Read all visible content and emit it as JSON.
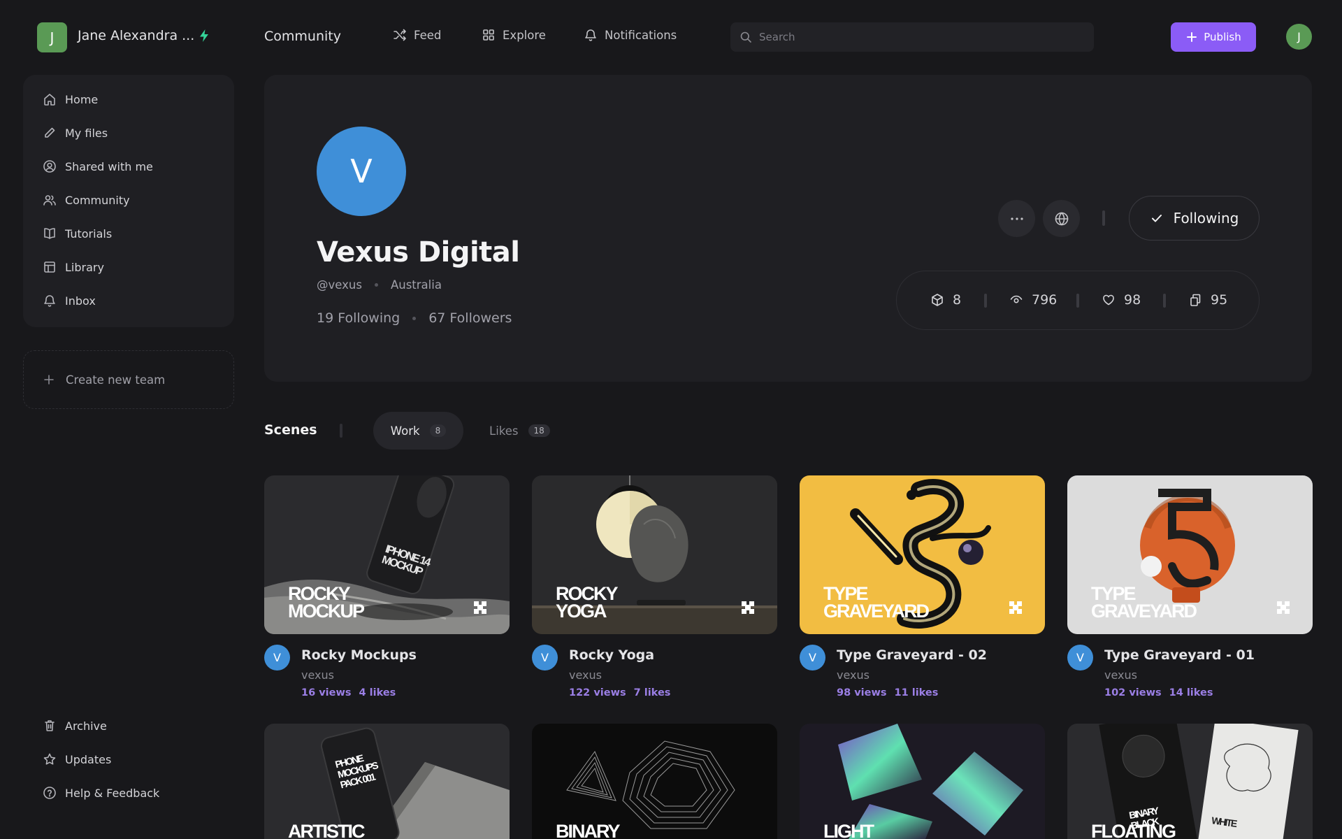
{
  "workspace": {
    "avatar_letter": "J",
    "name": "Jane Alexandra ...",
    "accent": "#34d399"
  },
  "header": {
    "page_title": "Community",
    "nav": [
      {
        "label": "Feed",
        "icon": "shuffle-icon"
      },
      {
        "label": "Explore",
        "icon": "grid-icon"
      },
      {
        "label": "Notifications",
        "icon": "bell-icon"
      }
    ],
    "search_placeholder": "Search",
    "publish_label": "Publish",
    "publish_color": "#8b5cf6",
    "user_avatar_letter": "J"
  },
  "sidebar": {
    "items": [
      {
        "label": "Home",
        "icon": "home-icon"
      },
      {
        "label": "My files",
        "icon": "pencil-icon"
      },
      {
        "label": "Shared with me",
        "icon": "user-circle-icon"
      },
      {
        "label": "Community",
        "icon": "users-icon"
      },
      {
        "label": "Tutorials",
        "icon": "book-icon"
      },
      {
        "label": "Library",
        "icon": "library-icon"
      },
      {
        "label": "Inbox",
        "icon": "bell-icon"
      }
    ],
    "create_team_label": "Create new team",
    "bottom_items": [
      {
        "label": "Archive",
        "icon": "trash-icon"
      },
      {
        "label": "Updates",
        "icon": "star-icon"
      },
      {
        "label": "Help & Feedback",
        "icon": "help-circle-icon"
      }
    ]
  },
  "profile": {
    "avatar_letter": "V",
    "name": "Vexus Digital",
    "handle": "@vexus",
    "location": "Australia",
    "following": "19 Following",
    "followers": "67 Followers",
    "follow_button_label": "Following",
    "stats": [
      {
        "icon": "cube-icon",
        "value": "8"
      },
      {
        "icon": "eye-icon",
        "value": "796"
      },
      {
        "icon": "heart-icon",
        "value": "98"
      },
      {
        "icon": "copy-icon",
        "value": "95"
      }
    ]
  },
  "scenes": {
    "title": "Scenes",
    "tabs": [
      {
        "label": "Work",
        "count": "8"
      },
      {
        "label": "Likes",
        "count": "18"
      }
    ],
    "cards": [
      {
        "title": "Rocky Mockups",
        "author": "vexus",
        "views": "16 views",
        "likes": "4 likes",
        "thumb_text": [
          "ROCKY",
          "MOCKUP"
        ],
        "phone_text": [
          "IPHONE 14",
          "MOCKUP"
        ]
      },
      {
        "title": "Rocky Yoga",
        "author": "vexus",
        "views": "122 views",
        "likes": "7 likes",
        "thumb_text": [
          "ROCKY",
          "YOGA"
        ]
      },
      {
        "title": "Type Graveyard - 02",
        "author": "vexus",
        "views": "98 views",
        "likes": "11 likes",
        "thumb_text": [
          "TYPE",
          "GRAVEYARD"
        ]
      },
      {
        "title": "Type Graveyard - 01",
        "author": "vexus",
        "views": "102 views",
        "likes": "14 likes",
        "thumb_text": [
          "TYPE",
          "GRAVEYARD"
        ]
      },
      {
        "thumb_text": [
          "ARTISTIC"
        ],
        "phone_text": [
          "PHONE",
          "MOCKUPS",
          "PACK 001"
        ]
      },
      {
        "thumb_text": [
          "BINARY"
        ]
      },
      {
        "thumb_text": [
          "LIGHT"
        ]
      },
      {
        "thumb_text": [
          "FLOATING"
        ],
        "phone_text": [
          "BINARY",
          "BLACK"
        ],
        "side_text": "WHITE"
      }
    ],
    "card_avatar_letter": "V"
  }
}
